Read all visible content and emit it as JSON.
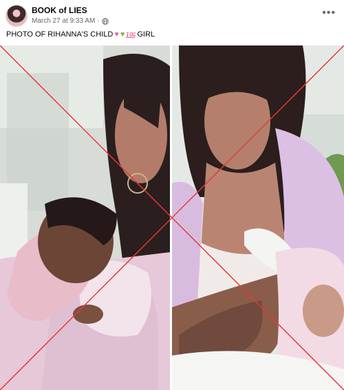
{
  "post": {
    "page_name": "BOOK of LIES",
    "timestamp": "March 27 at 9:33 AM",
    "separator": "·",
    "privacy_icon": "globe-icon",
    "more_icon": "more-options-icon",
    "caption_text": "PHOTO OF RIHANNA'S CHILD",
    "caption_emojis": [
      "pink-heart",
      "green-heart",
      "100"
    ],
    "caption_tail": "GIRL"
  },
  "photos": [
    {
      "name": "woman-holding-newborn-photo"
    },
    {
      "name": "woman-bottle-feeding-baby-photo"
    }
  ],
  "overlay": {
    "name": "false-cross-overlay",
    "color": "#e53935"
  }
}
